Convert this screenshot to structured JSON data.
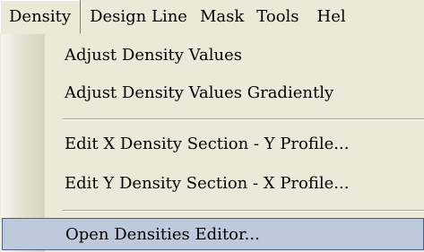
{
  "menubar": {
    "items": [
      {
        "label": "Density"
      },
      {
        "label": "Design Line"
      },
      {
        "label": "Mask"
      },
      {
        "label": "Tools"
      },
      {
        "label": "Hel"
      }
    ]
  },
  "dropdown": {
    "items": [
      {
        "label": "Adjust Density Values"
      },
      {
        "label": "Adjust Density Values Gradiently"
      },
      {
        "label": "Edit X Density Section - Y Profile..."
      },
      {
        "label": "Edit Y Density Section - X Profile..."
      },
      {
        "label": "Open Densities Editor..."
      }
    ]
  },
  "colors": {
    "menu_background": "#ece9d8",
    "selected_background": "#bfc9dc",
    "selected_border": "#4a5e86"
  }
}
